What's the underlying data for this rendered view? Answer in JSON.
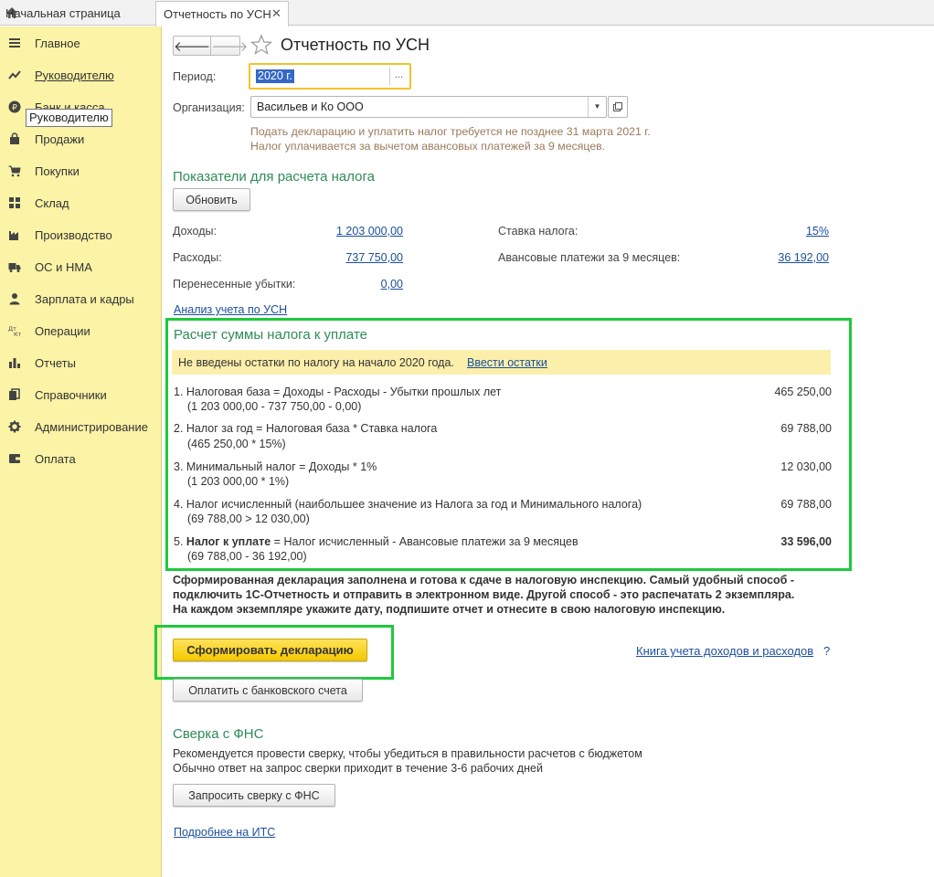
{
  "tabs": {
    "home_label": "Начальная страница",
    "active_label": "Отчетность по УСН"
  },
  "sidebar": {
    "items": [
      {
        "label": "Главное"
      },
      {
        "label": "Руководителю"
      },
      {
        "label": "Банк и касса"
      },
      {
        "label": "Продажи"
      },
      {
        "label": "Покупки"
      },
      {
        "label": "Склад"
      },
      {
        "label": "Производство"
      },
      {
        "label": "ОС и НМА"
      },
      {
        "label": "Зарплата и кадры"
      },
      {
        "label": "Операции"
      },
      {
        "label": "Отчеты"
      },
      {
        "label": "Справочники"
      },
      {
        "label": "Администрирование"
      },
      {
        "label": "Оплата"
      }
    ],
    "tooltip": "Руководителю"
  },
  "header": {
    "title": "Отчетность по УСН"
  },
  "form": {
    "period_label": "Период:",
    "period_value": "2020 г.",
    "period_dots": "...",
    "org_label": "Организация:",
    "org_value": "Васильев и Ко ООО",
    "note1": "Подать декларацию и уплатить налог требуется не позднее 31 марта 2021 г.",
    "note2": "Налог уплачивается за вычетом авансовых платежей за 9 месяцев."
  },
  "indicators": {
    "heading": "Показатели для расчета налога",
    "refresh": "Обновить",
    "income_label": "Доходы:",
    "income_value": "1 203 000,00",
    "expense_label": "Расходы:",
    "expense_value": "737 750,00",
    "losses_label": "Перенесенные убытки:",
    "losses_value": "0,00",
    "rate_label": "Ставка налога:",
    "rate_value": "15%",
    "advance_label": "Авансовые платежи за 9 месяцев:",
    "advance_value": "36 192,00",
    "analysis_link": "Анализ учета по УСН"
  },
  "calc": {
    "heading": "Расчет суммы налога к уплате",
    "warn_text": "Не введены остатки по налогу на начало 2020 года.",
    "warn_link": "Ввести остатки",
    "rows": [
      {
        "title": "1. Налоговая база = Доходы - Расходы - Убытки прошлых лет",
        "sub": "(1 203 000,00 - 737 750,00 - 0,00)",
        "value": "465 250,00"
      },
      {
        "title": "2. Налог за год = Налоговая база * Ставка налога",
        "sub": "(465 250,00 * 15%)",
        "value": "69 788,00"
      },
      {
        "title": "3. Минимальный налог = Доходы * 1%",
        "sub": "(1 203 000,00 * 1%)",
        "value": "12 030,00"
      },
      {
        "title": "4. Налог исчисленный (наибольшее значение из Налога за год и Минимального налога)",
        "sub": "(69 788,00 > 12 030,00)",
        "value": "69 788,00"
      },
      {
        "num": "5.",
        "bold_part": "Налог к уплате",
        "rest": " = Налог исчисленный - Авансовые платежи за 9 месяцев",
        "sub": "(69 788,00 - 36 192,00)",
        "value": "33 596,00"
      }
    ]
  },
  "declaration": {
    "text": "Сформированная декларация заполнена и готова к сдаче в налоговую инспекцию. Самый удобный способ - подключить 1С-Отчетность и отправить в электронном виде. Другой способ - это распечатать 2 экземпляра. На каждом экземпляре укажите дату, подпишите отчет и отнесите в свою налоговую инспекцию.",
    "make_button": "Сформировать декларацию",
    "book_link": "Книга учета доходов и расходов",
    "help": "?",
    "pay_button": "Оплатить с банковского счета"
  },
  "fns": {
    "heading": "Сверка с ФНС",
    "text1": "Рекомендуется провести сверку, чтобы убедиться в правильности расчетов с бюджетом",
    "text2": "Обычно ответ на запрос сверки приходит в течение 3-6 рабочих дней",
    "request_button": "Запросить сверку с ФНС",
    "its_link": "Подробнее на ИТС"
  }
}
